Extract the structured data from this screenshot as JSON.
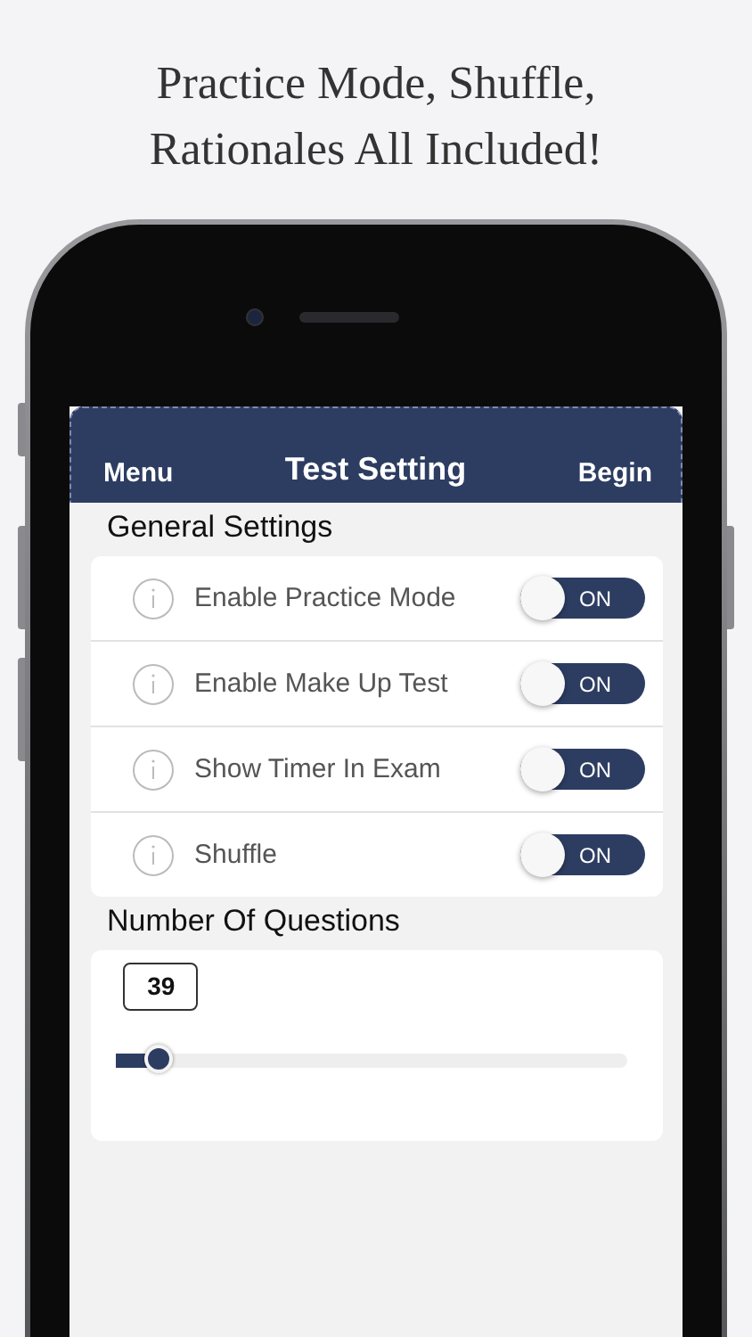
{
  "headline": [
    "Practice Mode, Shuffle,",
    "Rationales All Included!"
  ],
  "nav": {
    "left": "Menu",
    "title": "Test Setting",
    "right": "Begin"
  },
  "general_settings": {
    "heading": "General Settings",
    "items": [
      {
        "label": "Enable Practice Mode",
        "toggle_label": "ON",
        "on": true
      },
      {
        "label": "Enable Make Up Test",
        "toggle_label": "ON",
        "on": true
      },
      {
        "label": "Show Timer In Exam",
        "toggle_label": "ON",
        "on": true
      },
      {
        "label": "Shuffle",
        "toggle_label": "ON",
        "on": true
      }
    ]
  },
  "questions": {
    "heading": "Number Of Questions",
    "value": "39",
    "level": 0.085
  }
}
